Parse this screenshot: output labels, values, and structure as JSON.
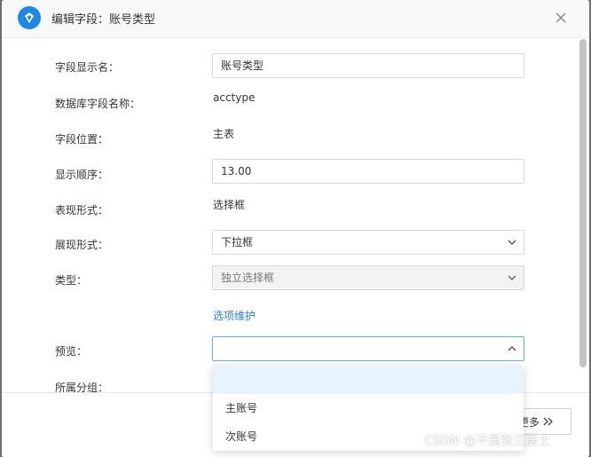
{
  "dialog": {
    "title": "编辑字段：账号类型",
    "icons": {
      "logo": "app-logo-icon",
      "close": "close-icon"
    }
  },
  "form": {
    "display_name": {
      "label": "字段显示名：",
      "value": "账号类型"
    },
    "db_field_name": {
      "label": "数据库字段名称：",
      "value": "acctype"
    },
    "field_position": {
      "label": "字段位置：",
      "value": "主表"
    },
    "display_order": {
      "label": "显示顺序：",
      "value": "13.00"
    },
    "presentation_form": {
      "label": "表现形式：",
      "value": "选择框"
    },
    "display_form": {
      "label": "展现形式：",
      "value": "下拉框"
    },
    "type": {
      "label": "类型：",
      "value": "独立选择框"
    },
    "option_maintenance_link": "选项维护",
    "preview": {
      "label": "预览：",
      "value": "",
      "options": [
        "",
        "主账号",
        "次账号"
      ]
    },
    "group": {
      "label": "所属分组："
    }
  },
  "footer": {
    "more_label": "更多"
  },
  "watermark": "CSDN @不是张三居士",
  "colors": {
    "accent": "#1e88e5",
    "link": "#2d82d6",
    "focus_border": "#5ab3e6",
    "highlight": "#e8f4fd"
  }
}
